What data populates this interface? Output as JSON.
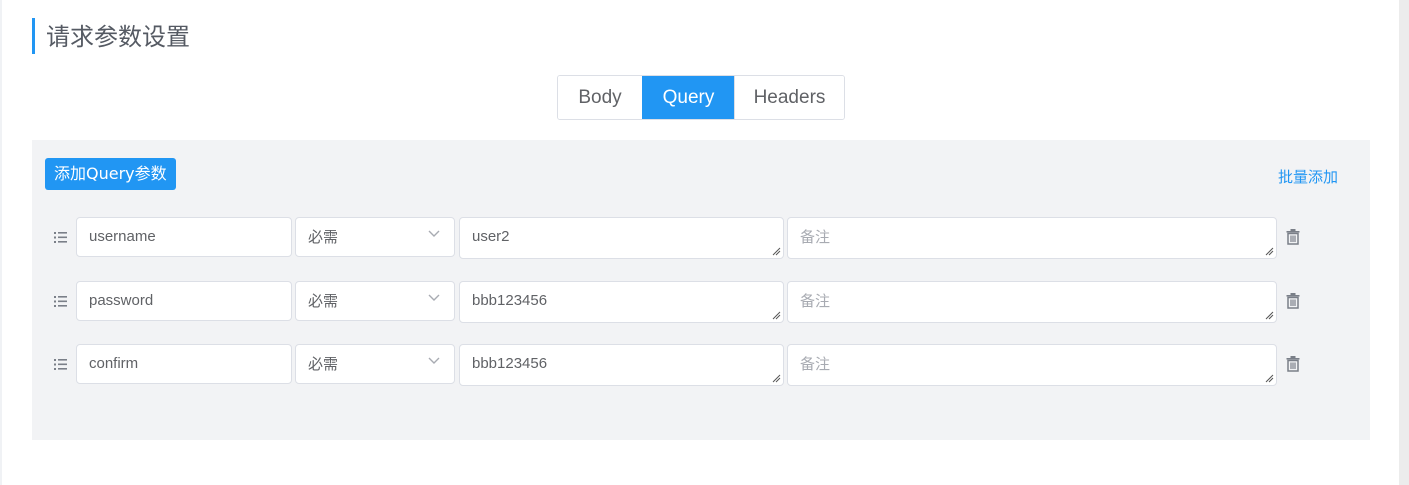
{
  "section": {
    "title": "请求参数设置"
  },
  "tabs": [
    {
      "label": "Body",
      "active": false
    },
    {
      "label": "Query",
      "active": true
    },
    {
      "label": "Headers",
      "active": false
    }
  ],
  "panel": {
    "add_button_label": "添加Query参数",
    "batch_add_label": "批量添加"
  },
  "params": [
    {
      "name": "username",
      "required": "必需",
      "value": "user2",
      "note_placeholder": "备注"
    },
    {
      "name": "password",
      "required": "必需",
      "value": "bbb123456",
      "note_placeholder": "备注"
    },
    {
      "name": "confirm",
      "required": "必需",
      "value": "bbb123456",
      "note_placeholder": "备注"
    }
  ],
  "icons": {
    "drag": "list-drag-icon",
    "dropdown": "chevron-down-icon",
    "delete": "trash-icon",
    "resize": "resize-handle-icon"
  },
  "colors": {
    "accent": "#2196f3",
    "panel_bg": "#f2f3f5",
    "border": "#dcdfe6",
    "placeholder": "#a8abb2"
  }
}
